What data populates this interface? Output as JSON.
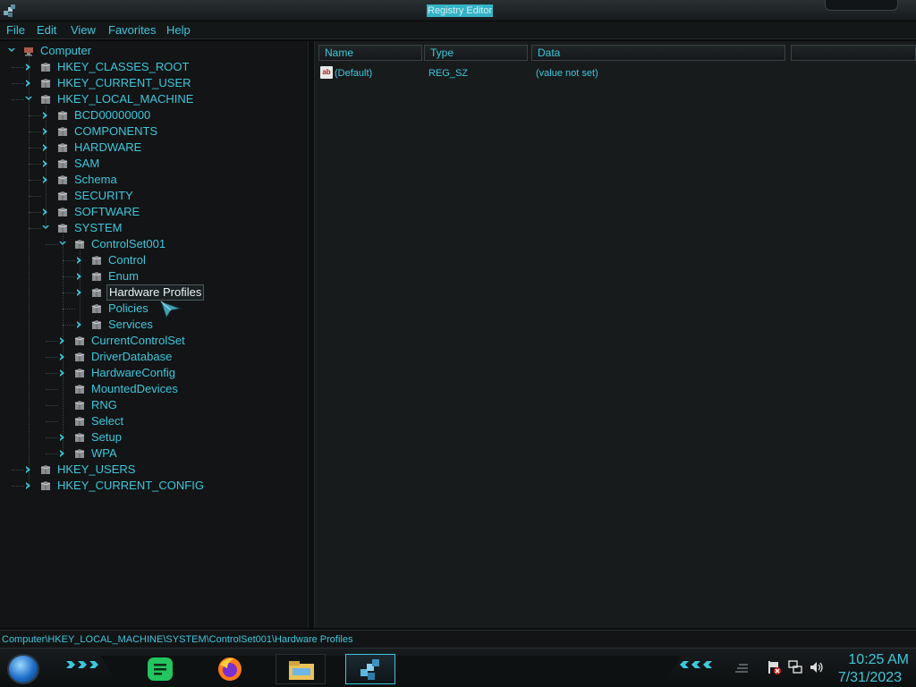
{
  "window": {
    "title": "Registry Editor"
  },
  "menu": [
    "File",
    "Edit",
    "View",
    "Favorites",
    "Help"
  ],
  "tree": [
    {
      "label": "Computer",
      "level": 0,
      "expander": "open"
    },
    {
      "label": "HKEY_CLASSES_ROOT",
      "level": 1,
      "expander": "closed"
    },
    {
      "label": "HKEY_CURRENT_USER",
      "level": 1,
      "expander": "closed"
    },
    {
      "label": "HKEY_LOCAL_MACHINE",
      "level": 1,
      "expander": "open"
    },
    {
      "label": "BCD00000000",
      "level": 2,
      "expander": "closed"
    },
    {
      "label": "COMPONENTS",
      "level": 2,
      "expander": "closed"
    },
    {
      "label": "HARDWARE",
      "level": 2,
      "expander": "closed"
    },
    {
      "label": "SAM",
      "level": 2,
      "expander": "closed"
    },
    {
      "label": "Schema",
      "level": 2,
      "expander": "closed"
    },
    {
      "label": "SECURITY",
      "level": 2,
      "expander": "none"
    },
    {
      "label": "SOFTWARE",
      "level": 2,
      "expander": "closed"
    },
    {
      "label": "SYSTEM",
      "level": 2,
      "expander": "open"
    },
    {
      "label": "ControlSet001",
      "level": 3,
      "expander": "open"
    },
    {
      "label": "Control",
      "level": 4,
      "expander": "closed"
    },
    {
      "label": "Enum",
      "level": 4,
      "expander": "closed"
    },
    {
      "label": "Hardware Profiles",
      "level": 4,
      "expander": "closed",
      "selected": true
    },
    {
      "label": "Policies",
      "level": 4,
      "expander": "none"
    },
    {
      "label": "Services",
      "level": 4,
      "expander": "closed"
    },
    {
      "label": "CurrentControlSet",
      "level": 3,
      "expander": "closed"
    },
    {
      "label": "DriverDatabase",
      "level": 3,
      "expander": "closed"
    },
    {
      "label": "HardwareConfig",
      "level": 3,
      "expander": "closed"
    },
    {
      "label": "MountedDevices",
      "level": 3,
      "expander": "none"
    },
    {
      "label": "RNG",
      "level": 3,
      "expander": "none"
    },
    {
      "label": "Select",
      "level": 3,
      "expander": "none"
    },
    {
      "label": "Setup",
      "level": 3,
      "expander": "closed"
    },
    {
      "label": "WPA",
      "level": 3,
      "expander": "closed"
    },
    {
      "label": "HKEY_USERS",
      "level": 1,
      "expander": "closed"
    },
    {
      "label": "HKEY_CURRENT_CONFIG",
      "level": 1,
      "expander": "closed"
    }
  ],
  "list": {
    "columns": [
      "Name",
      "Type",
      "Data"
    ],
    "rows": [
      {
        "name": "(Default)",
        "type": "REG_SZ",
        "data": "(value not set)",
        "icon": "string-value-icon"
      }
    ]
  },
  "status": {
    "path": "Computer\\HKEY_LOCAL_MACHINE\\SYSTEM\\ControlSet001\\Hardware Profiles"
  },
  "taskbar": {
    "pinned": [
      "start-orb-icon",
      "notes-app-icon",
      "firefox-icon",
      "file-explorer-icon",
      "registry-editor-icon"
    ],
    "tray_icons": [
      "action-center-flag-icon",
      "network-icon",
      "volume-icon"
    ]
  },
  "clock": {
    "time": "10:25 AM",
    "date": "7/31/2023"
  },
  "colors": {
    "accent": "#3fc7dc",
    "background": "#121415",
    "selection_text": "#eaf6f8"
  }
}
